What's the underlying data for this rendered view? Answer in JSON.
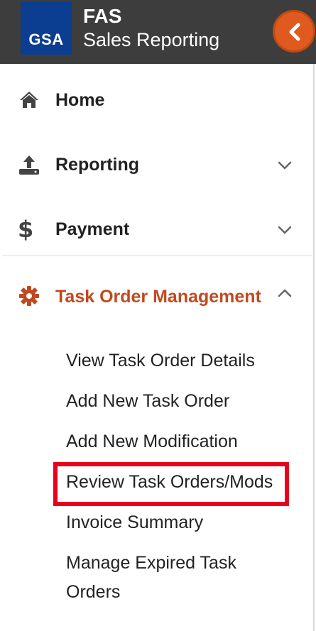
{
  "header": {
    "logo_text": "GSA",
    "title": "FAS",
    "subtitle": "Sales Reporting",
    "collapse_icon": "chevron-left-icon",
    "brand_color": "#3d3d3d",
    "accent_color": "#e05a1f"
  },
  "nav": {
    "items": [
      {
        "label": "Home",
        "icon": "home-icon"
      },
      {
        "label": "Reporting",
        "icon": "upload-icon",
        "chevron": "chevron-down-icon"
      },
      {
        "label": "Payment",
        "icon": "dollar-icon",
        "chevron": "chevron-down-icon"
      },
      {
        "label": "Task Order Management",
        "icon": "gear-icon",
        "chevron": "chevron-up-icon",
        "active_color": "#c04a1f"
      }
    ],
    "task_order_submenu": [
      "View Task Order Details",
      "Add New Task Order",
      "Add New Modification",
      "Review Task Orders/Mods",
      "Invoice Summary",
      "Manage Expired Task",
      "Orders"
    ],
    "highlight_color": "#e8001c"
  }
}
